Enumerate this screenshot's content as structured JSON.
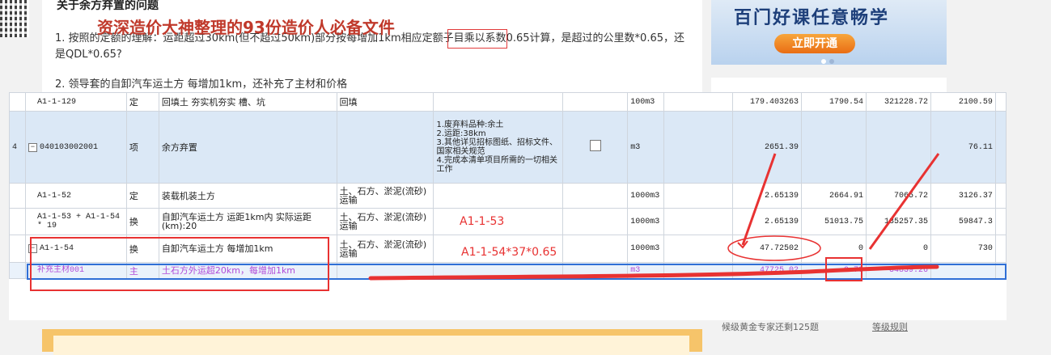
{
  "article": {
    "title": "关于余方弃置的问题",
    "q1": "1.  按照的定额的理解：运距超过30km(但不超过50km)部分按每增加1km相应定额子目乘以系数0.65计算，是超过的公里数*0.65，还是QDL*0.65?",
    "q2": "2.  领导套的自卸汽车运土方 每增加1km，还补充了主材和价格"
  },
  "banner": {
    "title": "百门好课任意畅学",
    "button": "立即开通"
  },
  "bottom": {
    "title": "资深造价大神整理的93份造价人必备文件",
    "side_note": "候级黄金专家还剩125题",
    "side_link": "等级规则"
  },
  "table": {
    "rows": [
      {
        "idx": "",
        "code": "A1-1-129",
        "type": "定",
        "name": "回填土 夯实机夯实 槽、坑",
        "feature": "回填",
        "desc": "",
        "check": false,
        "unit": "100m3",
        "v1": "179.403263",
        "v2": "1790.54",
        "v3": "321228.72",
        "v4": "2100.59",
        "style": "white",
        "tree": ""
      },
      {
        "idx": "4",
        "code": "040103002001",
        "type": "项",
        "name": "余方弃置",
        "feature": "",
        "desc": "1.废弃料品种:余土\n2.运距:38km\n3.其他详见招标图纸、招标文件、国家相关规范\n4.完成本清单项目所需的一切相关工作",
        "check": true,
        "unit": "m3",
        "v1": "2651.39",
        "v2": "",
        "v3": "",
        "v4": "76.11",
        "style": "blue",
        "tree": "−"
      },
      {
        "idx": "",
        "code": "A1-1-52",
        "type": "定",
        "name": "装载机装土方",
        "feature": "土、石方、淤泥(流砂)运输",
        "desc": "",
        "check": false,
        "unit": "1000m3",
        "v1": "2.65139",
        "v2": "2664.91",
        "v3": "7065.72",
        "v4": "3126.37",
        "style": "white",
        "tree": ""
      },
      {
        "idx": "",
        "code": "A1-1-53 + A1-1-54 * 19",
        "type": "换",
        "name": "自卸汽车运土方 运距1km内  实际运距(km):20",
        "feature": "土、石方、淤泥(流砂)运输",
        "desc": "",
        "check": false,
        "unit": "1000m3",
        "v1": "2.65139",
        "v2": "51013.75",
        "v3": "135257.35",
        "v4": "59847.3",
        "style": "white",
        "tree": ""
      },
      {
        "idx": "",
        "code": "A1-1-54",
        "type": "换",
        "name": "自卸汽车运土方 每增加1km",
        "feature": "土、石方、淤泥(流砂)运输",
        "desc": "",
        "check": false,
        "unit": "1000m3",
        "v1": "47.72502",
        "v2": "0",
        "v3": "0",
        "v4": "730",
        "style": "white",
        "tree": "−"
      },
      {
        "idx": "",
        "code": "补充主材001",
        "type": "主",
        "name": "土石方外运超20km，每增加1km",
        "feature": "",
        "desc": "",
        "check": false,
        "unit": "m3",
        "v1": "47725.02",
        "v2": "0.73",
        "v3": "34839.26",
        "v4": "",
        "style": "sel",
        "tree": ""
      }
    ]
  },
  "annotations": {
    "label1": "A1-1-53",
    "label2": "A1-1-54*37*0.65"
  },
  "colors": {
    "annotation": "#e83232",
    "selection": "#2f6fd6",
    "row_blue": "#dbe8f6"
  }
}
